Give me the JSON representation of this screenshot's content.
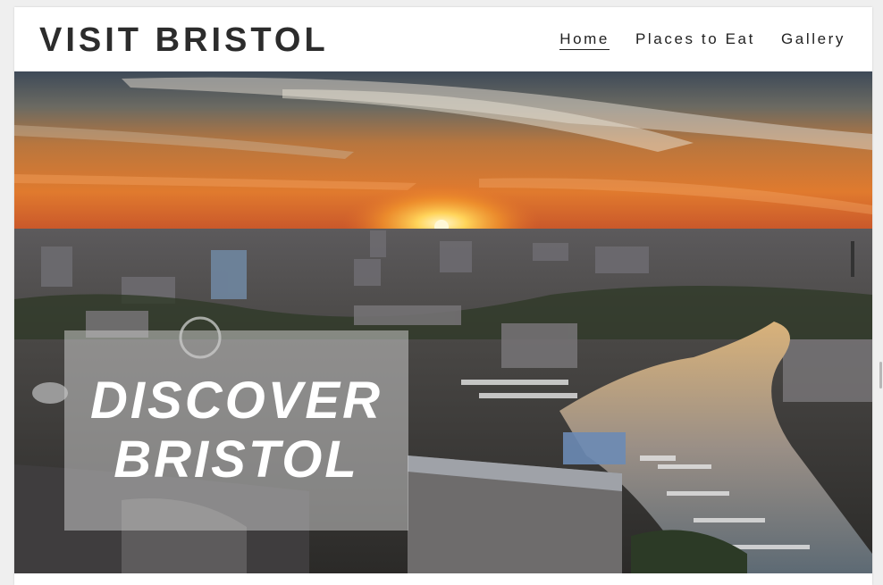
{
  "header": {
    "logo": "VISIT BRISTOL",
    "nav": [
      {
        "label": "Home",
        "active": true
      },
      {
        "label": "Places to Eat",
        "active": false
      },
      {
        "label": "Gallery",
        "active": false
      }
    ]
  },
  "hero": {
    "line1": "DISCOVER",
    "line2": "BRISTOL",
    "image_subject": "aerial photo of Bristol harbour and city skyline at sunset"
  },
  "colors": {
    "text": "#2c2c2c",
    "hero_box": "rgba(200,200,200,0.55)",
    "hero_text": "#ffffff"
  }
}
